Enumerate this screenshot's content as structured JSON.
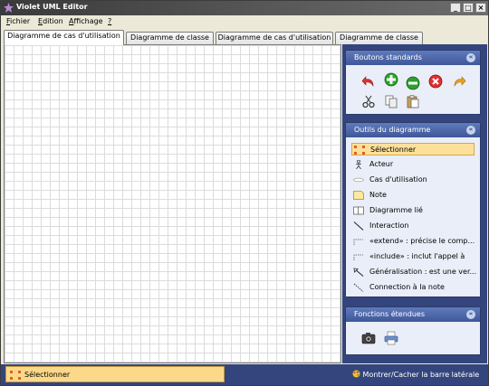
{
  "window": {
    "title": "Violet UML Editor",
    "minimize_label": "_",
    "maximize_label": "□",
    "close_label": "×"
  },
  "menu": [
    {
      "first": "F",
      "rest": "ichier"
    },
    {
      "first": "E",
      "rest": "dition"
    },
    {
      "first": "A",
      "rest": "ffichage"
    },
    {
      "first": "?",
      "rest": ""
    }
  ],
  "tabs": [
    "Diagramme de cas d'utilisation",
    "Diagramme de classe",
    "Diagramme de cas d'utilisation",
    "Diagramme de classe"
  ],
  "sidebar": {
    "standard_title": "Boutons standards",
    "tools_title": "Outils du diagramme",
    "tools": [
      {
        "label": "Sélectionner",
        "icon": "select-icon"
      },
      {
        "label": "Acteur",
        "icon": "actor-icon"
      },
      {
        "label": "Cas d'utilisation",
        "icon": "use-case-icon"
      },
      {
        "label": "Note",
        "icon": "note-icon"
      },
      {
        "label": "Diagramme lié",
        "icon": "linked-diagram-icon"
      },
      {
        "label": "Interaction",
        "icon": "interaction-icon"
      },
      {
        "label": "«extend» : précise le comp...",
        "icon": "extend-icon"
      },
      {
        "label": "«include» : inclut l'appel à",
        "icon": "include-icon"
      },
      {
        "label": "Généralisation : est une ver...",
        "icon": "generalization-icon"
      },
      {
        "label": "Connection à la note",
        "icon": "note-connection-icon"
      }
    ],
    "extended_title": "Fonctions étendues",
    "collapse_glyph": "«"
  },
  "status": {
    "current_tool": "Sélectionner",
    "toggle_sidebar": "Montrer/Cacher la barre latérale"
  },
  "colors": {
    "sidebar_bg": "#34457e",
    "selected_tool": "#fde19a"
  }
}
